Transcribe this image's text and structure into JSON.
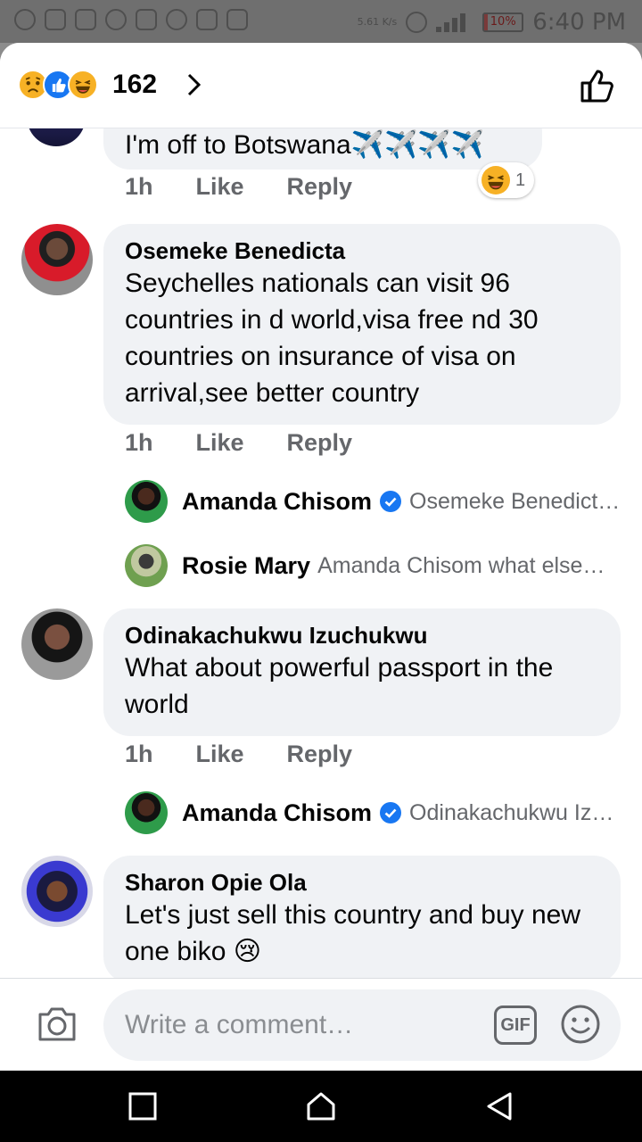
{
  "status_bar": {
    "time": "6:40 PM",
    "battery": "10%",
    "speed": "5.61 K/s"
  },
  "header": {
    "reaction_count": "162",
    "reaction_types": [
      "sad-emoji",
      "like-icon",
      "haha-emoji"
    ]
  },
  "comments": [
    {
      "text": "I'm off to Botswana✈️✈️✈️✈️",
      "time": "1h",
      "like_label": "Like",
      "reply_label": "Reply",
      "reaction": {
        "icon": "haha-emoji",
        "count": "1"
      }
    },
    {
      "author": "Osemeke Benedicta",
      "text": "Seychelles nationals can visit 96 countries in d world,visa free nd 30 countries on insurance of visa on arrival,see better country",
      "time": "1h",
      "like_label": "Like",
      "reply_label": "Reply",
      "replies": [
        {
          "author": "Amanda Chisom",
          "verified": true,
          "preview": "Osemeke Benedict…"
        },
        {
          "author": "Rosie Mary",
          "verified": false,
          "preview": "Amanda Chisom what else…"
        }
      ]
    },
    {
      "author": "Odinakachukwu Izuchukwu",
      "text": "What about powerful passport in the world",
      "time": "1h",
      "like_label": "Like",
      "reply_label": "Reply",
      "replies": [
        {
          "author": "Amanda Chisom",
          "verified": true,
          "preview": "Odinakachukwu Iz…"
        }
      ]
    },
    {
      "author": "Sharon Opie Ola",
      "text": "Let's just sell this country and buy new one biko 😢"
    }
  ],
  "composer": {
    "placeholder": "Write a comment…",
    "gif_label": "GIF"
  },
  "colors": {
    "bubble": "#f0f2f5",
    "secondary_text": "#65676b",
    "verified": "#1877f2"
  }
}
